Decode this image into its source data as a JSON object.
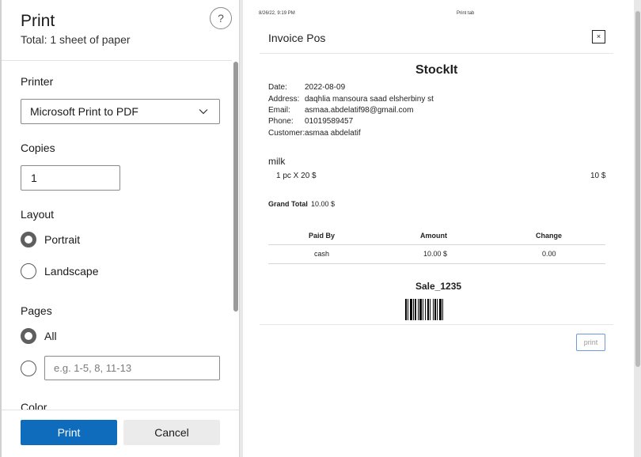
{
  "dialog": {
    "title": "Print",
    "subtitle": "Total: 1 sheet of paper",
    "help_label": "?",
    "printer": {
      "label": "Printer",
      "value": "Microsoft Print to PDF"
    },
    "copies": {
      "label": "Copies",
      "value": "1"
    },
    "layout": {
      "label": "Layout",
      "options": [
        "Portrait",
        "Landscape"
      ],
      "selected": "Portrait"
    },
    "pages": {
      "label": "Pages",
      "all_label": "All",
      "range_placeholder": "e.g. 1-5, 8, 11-13",
      "selected": "All"
    },
    "color": {
      "label": "Color"
    },
    "print_button": "Print",
    "cancel_button": "Cancel"
  },
  "preview": {
    "header_date": "8/26/22, 9:19 PM",
    "header_title": "Print tab",
    "invoice_title": "Invoice Pos",
    "close_label": "×",
    "shop_name": "StockIt",
    "info": [
      {
        "key": "Date:",
        "value": "2022-08-09"
      },
      {
        "key": "Address:",
        "value": "daqhlia mansoura saad elsherbiny st"
      },
      {
        "key": "Email:",
        "value": "asmaa.abdelatif98@gmail.com"
      },
      {
        "key": "Phone:",
        "value": "01019589457"
      },
      {
        "key": "Customer:",
        "value": "asmaa abdelatif"
      }
    ],
    "item": {
      "name": "milk",
      "detail": "1 pc X 20 $",
      "total": "10 $"
    },
    "grand_total_label": "Grand Total",
    "grand_total_value": "10.00 $",
    "payments": {
      "headers": [
        "Paid By",
        "Amount",
        "Change"
      ],
      "rows": [
        [
          "cash",
          "10.00 $",
          "0.00"
        ]
      ]
    },
    "sale_id": "Sale_1235",
    "print_button": "print"
  }
}
